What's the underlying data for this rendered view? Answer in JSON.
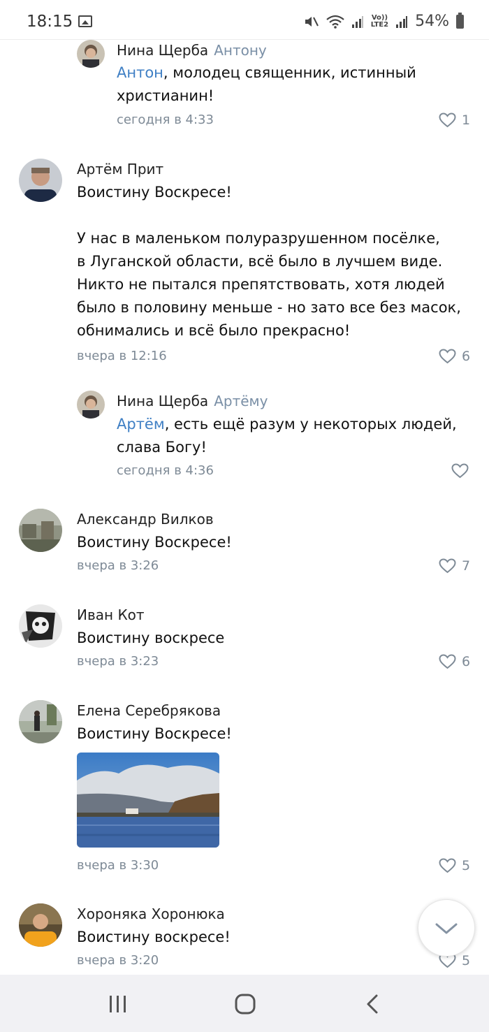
{
  "status_bar": {
    "time": "18:15",
    "network": "LTE2",
    "volte": "Vo))",
    "battery": "54%"
  },
  "comments": [
    {
      "author": "Нина Щерба",
      "reply_to": "Антону",
      "mention": "Антон",
      "text_line1": ", молодец священник, истинный",
      "text_line2": "христианин!",
      "time": "сегодня в 4:33",
      "likes": "1"
    },
    {
      "author": "Артём Прит",
      "text_line1": "Воистину Воскресе!",
      "text_line2": "",
      "text_line3": "У нас в маленьком полуразрушенном посёлке,",
      "text_line4": "в Луганской области, всё было в лучшем виде.",
      "text_line5": "Никто не пытался препятствовать, хотя людей",
      "text_line6": "было в половину меньше - но зато все без масок,",
      "text_line7": "обнимались и всё было прекрасно!",
      "time": "вчера в 12:16",
      "likes": "6"
    },
    {
      "author": "Нина Щерба",
      "reply_to": "Артёму",
      "mention": "Артём",
      "text_line1": ", есть ещё разум у некоторых людей,",
      "text_line2": "слава Богу!",
      "time": "сегодня в 4:36",
      "likes": ""
    },
    {
      "author": "Александр Вилков",
      "text": "Воистину Воскресе!",
      "time": "вчера в 3:26",
      "likes": "7"
    },
    {
      "author": "Иван Кот",
      "text": "Воистину воскресе",
      "time": "вчера в 3:23",
      "likes": "6"
    },
    {
      "author": "Елена Серебрякова",
      "text": "Воистину Воскресе!",
      "time": "вчера в 3:30",
      "likes": "5"
    },
    {
      "author": "Хороняка Хоронюка",
      "text": "Воистину воскресе!",
      "time": "вчера в 3:20",
      "likes": "5"
    }
  ],
  "icons": {
    "like": "heart-icon",
    "scroll_down": "chevron-down-icon",
    "nav_recents": "recents-icon",
    "nav_home": "home-icon",
    "nav_back": "back-icon"
  },
  "colors": {
    "mention": "#3f7fc4",
    "meta": "#7e8a96",
    "nav_bg": "#f1f1f4"
  }
}
